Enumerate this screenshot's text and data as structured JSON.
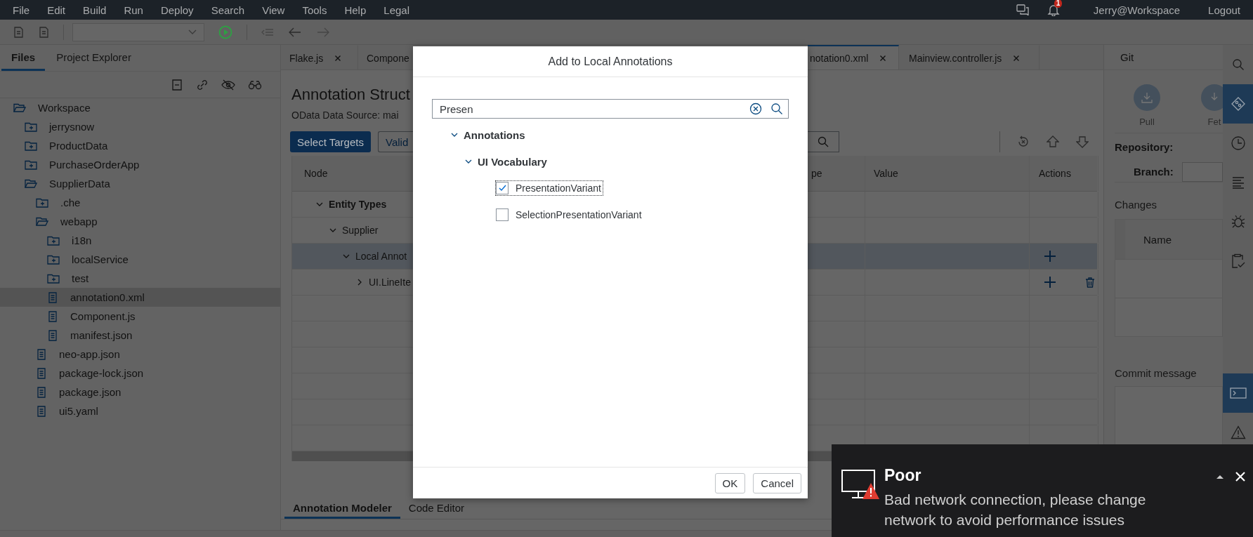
{
  "menu_bar": {
    "items": [
      "File",
      "Edit",
      "Build",
      "Run",
      "Deploy",
      "Search",
      "View",
      "Tools",
      "Help",
      "Legal"
    ],
    "notification_count": "1",
    "user": "Jerry@Workspace",
    "logout": "Logout"
  },
  "left_panel": {
    "tabs": [
      {
        "label": "Files",
        "selected": true
      },
      {
        "label": "Project Explorer",
        "selected": false
      }
    ],
    "tree": [
      {
        "label": "Workspace",
        "kind": "folder",
        "expanded": true,
        "selected": false,
        "children": [
          {
            "label": "jerrysnow",
            "kind": "folder",
            "expanded": false,
            "selected": false
          },
          {
            "label": "ProductData",
            "kind": "folder",
            "expanded": false,
            "selected": false
          },
          {
            "label": "PurchaseOrderApp",
            "kind": "folder",
            "expanded": false,
            "selected": false
          },
          {
            "label": "SupplierData",
            "kind": "folder",
            "expanded": true,
            "selected": false,
            "children": [
              {
                "label": ".che",
                "kind": "folder",
                "expanded": false,
                "selected": false
              },
              {
                "label": "webapp",
                "kind": "folder",
                "expanded": true,
                "selected": false,
                "children": [
                  {
                    "label": "i18n",
                    "kind": "folder",
                    "expanded": false,
                    "selected": false
                  },
                  {
                    "label": "localService",
                    "kind": "folder",
                    "expanded": false,
                    "selected": false
                  },
                  {
                    "label": "test",
                    "kind": "folder",
                    "expanded": false,
                    "selected": false
                  },
                  {
                    "label": "annotation0.xml",
                    "kind": "file",
                    "selected": true
                  },
                  {
                    "label": "Component.js",
                    "kind": "file",
                    "selected": false
                  },
                  {
                    "label": "manifest.json",
                    "kind": "file",
                    "selected": false
                  }
                ]
              },
              {
                "label": "neo-app.json",
                "kind": "file",
                "selected": false
              },
              {
                "label": "package-lock.json",
                "kind": "file",
                "selected": false
              },
              {
                "label": "package.json",
                "kind": "file",
                "selected": false
              },
              {
                "label": "ui5.yaml",
                "kind": "file",
                "selected": false
              }
            ]
          }
        ]
      }
    ]
  },
  "editor": {
    "tabs": [
      {
        "label": "Flake.js",
        "closable": true,
        "selected": false
      },
      {
        "label": "Compone",
        "closable": false,
        "selected": false
      },
      {
        "label": "notation0.xml",
        "closable": true,
        "selected": true
      },
      {
        "label": "Mainview.controller.js",
        "closable": true,
        "selected": false
      }
    ],
    "title": "Annotation Struct",
    "data_source": "OData Data Source: mai",
    "buttons": [
      {
        "label": "Select Targets",
        "kind": "primary"
      },
      {
        "label": "Valid",
        "kind": "default"
      }
    ],
    "table": {
      "columns": [
        {
          "label": "Node"
        },
        {
          "label": "pe"
        },
        {
          "label": "Value"
        },
        {
          "label": "Actions"
        }
      ],
      "rows": [
        {
          "node": "Entity Types",
          "bold": true,
          "expanded": true,
          "selected": false,
          "children": [
            {
              "node": "Supplier",
              "bold": false,
              "expanded": true,
              "selected": false,
              "children": [
                {
                  "node": "Local Annot",
                  "bold": false,
                  "expanded": true,
                  "selected": true,
                  "actions": [
                    {
                      "kind": "add"
                    }
                  ],
                  "children": [
                    {
                      "node": "UI.LineIte",
                      "bold": false,
                      "expanded": false,
                      "selected": false,
                      "actions": [
                        {
                          "kind": "add"
                        },
                        {
                          "kind": "delete"
                        }
                      ]
                    }
                  ]
                }
              ]
            }
          ]
        }
      ]
    },
    "bottom_tabs": [
      {
        "label": "Annotation Modeler",
        "selected": true
      },
      {
        "label": "Code Editor",
        "selected": false
      }
    ]
  },
  "git_panel": {
    "tab": "Git",
    "buttons": [
      {
        "label": "Pull",
        "kind": "pull"
      },
      {
        "label": "Fet",
        "kind": "fetch"
      }
    ],
    "repository_label": "Repository:",
    "branch_label": "Branch:",
    "changes_label": "Changes",
    "changes_column": "Name",
    "commit_label": "Commit message"
  },
  "side_bar": {
    "top": [
      {
        "kind": "search",
        "selected": false
      },
      {
        "kind": "git",
        "selected": true
      },
      {
        "kind": "history",
        "selected": false
      },
      {
        "kind": "outline",
        "selected": false
      },
      {
        "kind": "debug",
        "selected": false
      },
      {
        "kind": "review",
        "selected": false
      }
    ],
    "bottom": [
      {
        "kind": "terminal",
        "selected": true
      },
      {
        "kind": "problems",
        "selected": false
      }
    ]
  },
  "dialog": {
    "title": "Add to Local Annotations",
    "search": {
      "value": "Presen"
    },
    "tree": [
      {
        "label": "Annotations",
        "expanded": true,
        "children": [
          {
            "label": "UI Vocabulary",
            "expanded": true,
            "children": [
              {
                "label": "PresentationVariant",
                "checked": true,
                "focused": true
              },
              {
                "label": "SelectionPresentationVariant",
                "checked": false,
                "focused": false
              }
            ]
          }
        ]
      }
    ],
    "buttons": [
      "OK",
      "Cancel"
    ]
  },
  "toast": {
    "title": "Poor",
    "message": "Bad network connection, please change network to avoid performance issues"
  }
}
